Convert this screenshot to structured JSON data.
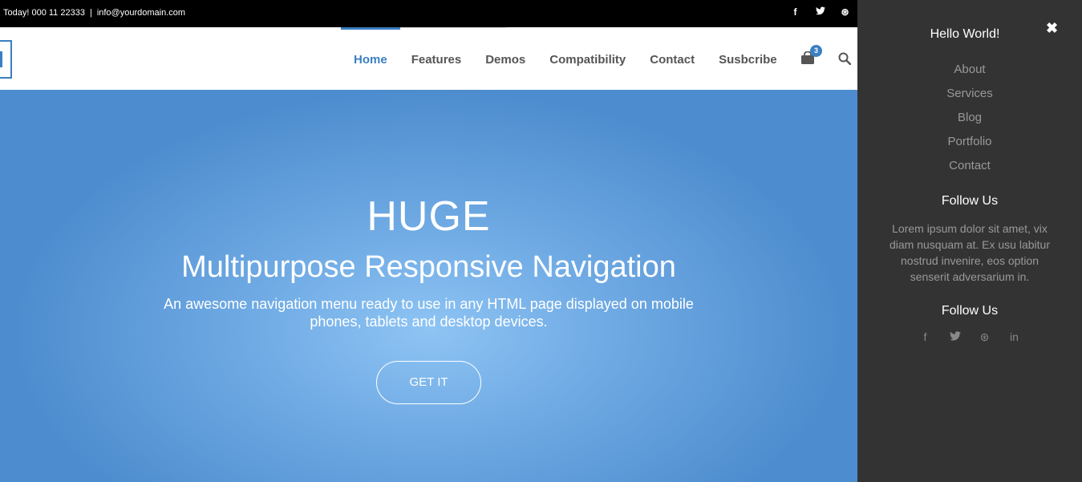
{
  "topbar": {
    "phone": "Today! 000 11 22333",
    "separator": "|",
    "email": "info@yourdomain.com",
    "social": [
      {
        "icon": "facebook-icon",
        "glyph": "f"
      },
      {
        "icon": "twitter-icon",
        "glyph": "🐦"
      },
      {
        "icon": "dribbble-icon",
        "glyph": "⊛"
      }
    ]
  },
  "nav": {
    "items": [
      "Home",
      "Features",
      "Demos",
      "Compatibility",
      "Contact",
      "Susbcribe"
    ],
    "active": "Home",
    "cart_count": "3"
  },
  "hero": {
    "title": "HUGE",
    "subtitle": "Multipurpose Responsive Navigation",
    "description": "An awesome navigation menu ready to use in any HTML page displayed on mobile phones, tablets and desktop devices.",
    "cta": "GET IT",
    "accent": "#3a7fc1"
  },
  "side_panel": {
    "close_glyph": "✖",
    "title": "Hello World!",
    "links": [
      "About",
      "Services",
      "Blog",
      "Portfolio",
      "Contact"
    ],
    "section1_title": "Follow Us",
    "blurb": "Lorem ipsum dolor sit amet, vix diam nusquam at. Ex usu labitur nostrud invenire, eos option senserit adversarium in.",
    "section2_title": "Follow Us",
    "social": [
      {
        "icon": "facebook-icon",
        "glyph": "f"
      },
      {
        "icon": "twitter-icon",
        "glyph": "🐦"
      },
      {
        "icon": "dribbble-icon",
        "glyph": "⊛"
      },
      {
        "icon": "linkedin-icon",
        "glyph": "in"
      }
    ]
  }
}
